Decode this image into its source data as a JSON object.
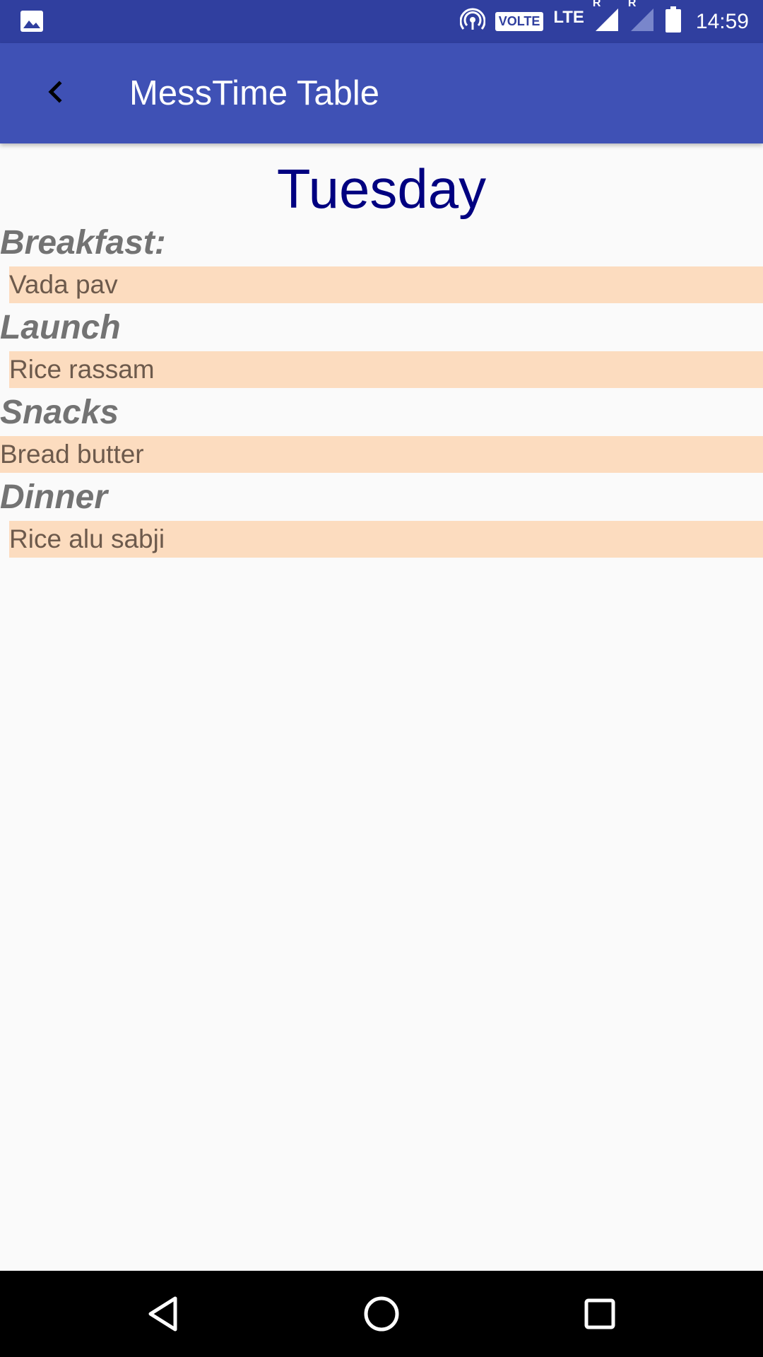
{
  "status_bar": {
    "volte": "VOLTE",
    "network": "LTE",
    "roaming_1": "R",
    "roaming_2": "R",
    "time": "14:59"
  },
  "app_bar": {
    "title": "MessTime Table"
  },
  "content": {
    "day": "Tuesday",
    "meals": [
      {
        "label": "Breakfast:",
        "value": "Vada pav"
      },
      {
        "label": "Launch",
        "value": "Rice rassam"
      },
      {
        "label": "Snacks",
        "value": "Bread butter"
      },
      {
        "label": "Dinner",
        "value": "Rice alu sabji"
      }
    ]
  },
  "icons": {
    "image_notification": "image-icon",
    "hotspot": "hotspot-icon",
    "signal": "signal-icon",
    "battery": "battery-icon",
    "back": "back-arrow-icon",
    "nav_back": "nav-back-icon",
    "nav_home": "nav-home-icon",
    "nav_recents": "nav-recents-icon"
  },
  "colors": {
    "status_bar": "#303f9f",
    "app_bar": "#3f51b5",
    "day_title": "#000080",
    "meal_highlight": "#fcdcbf",
    "meal_label": "#737373"
  }
}
